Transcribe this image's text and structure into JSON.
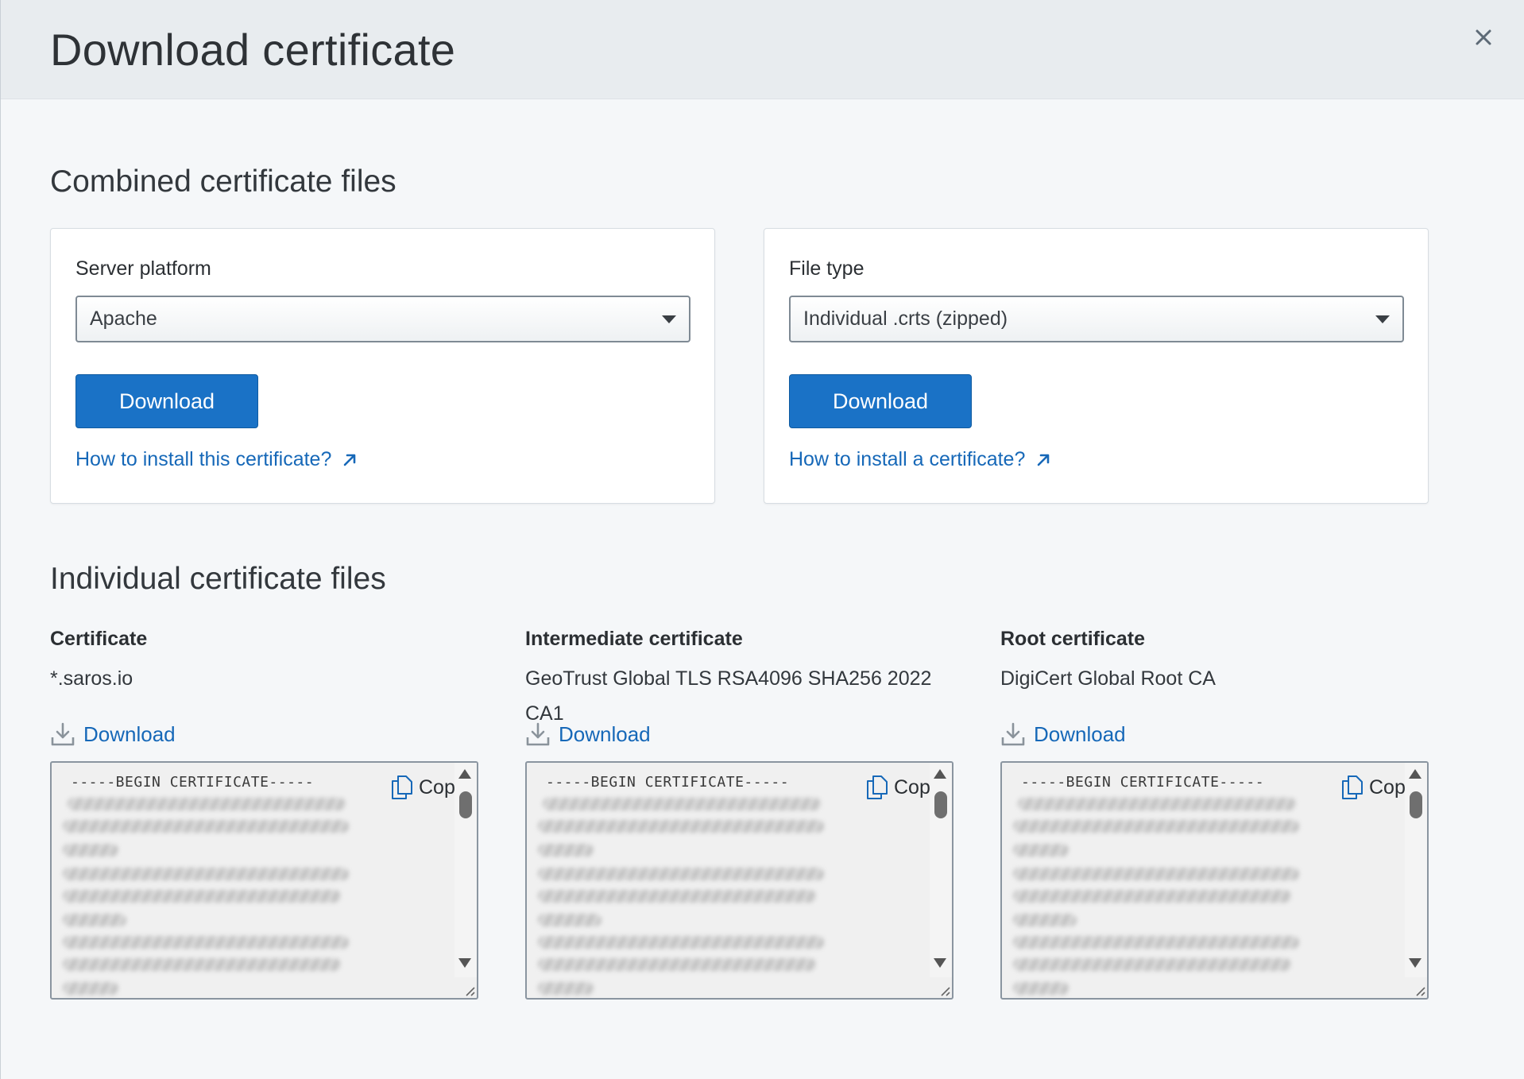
{
  "dialog": {
    "title": "Download certificate",
    "close_icon": "close-icon"
  },
  "combined": {
    "heading": "Combined certificate files",
    "server_card": {
      "label": "Server platform",
      "selected": "Apache",
      "button_label": "Download",
      "link_text": "How to install this certificate?"
    },
    "filetype_card": {
      "label": "File type",
      "selected": "Individual .crts (zipped)",
      "button_label": "Download",
      "link_text": "How to install a certificate?"
    }
  },
  "individual": {
    "heading": "Individual certificate files",
    "items": [
      {
        "label": "Certificate",
        "value": "*.saros.io",
        "download_label": "Download",
        "begin_text": "-----BEGIN CERTIFICATE-----",
        "copy_label": "Copy"
      },
      {
        "label": "Intermediate certificate",
        "value": "GeoTrust Global TLS RSA4096 SHA256 2022 CA1",
        "download_label": "Download",
        "begin_text": "-----BEGIN CERTIFICATE-----",
        "copy_label": "Copy"
      },
      {
        "label": "Root certificate",
        "value": "DigiCert Global Root CA",
        "download_label": "Download",
        "begin_text": "-----BEGIN CERTIFICATE-----",
        "copy_label": "Copy"
      }
    ]
  },
  "colors": {
    "primary": "#1a72c6",
    "link": "#1668b8",
    "header_bg": "#e8ecef",
    "page_bg": "#f5f7f9"
  }
}
